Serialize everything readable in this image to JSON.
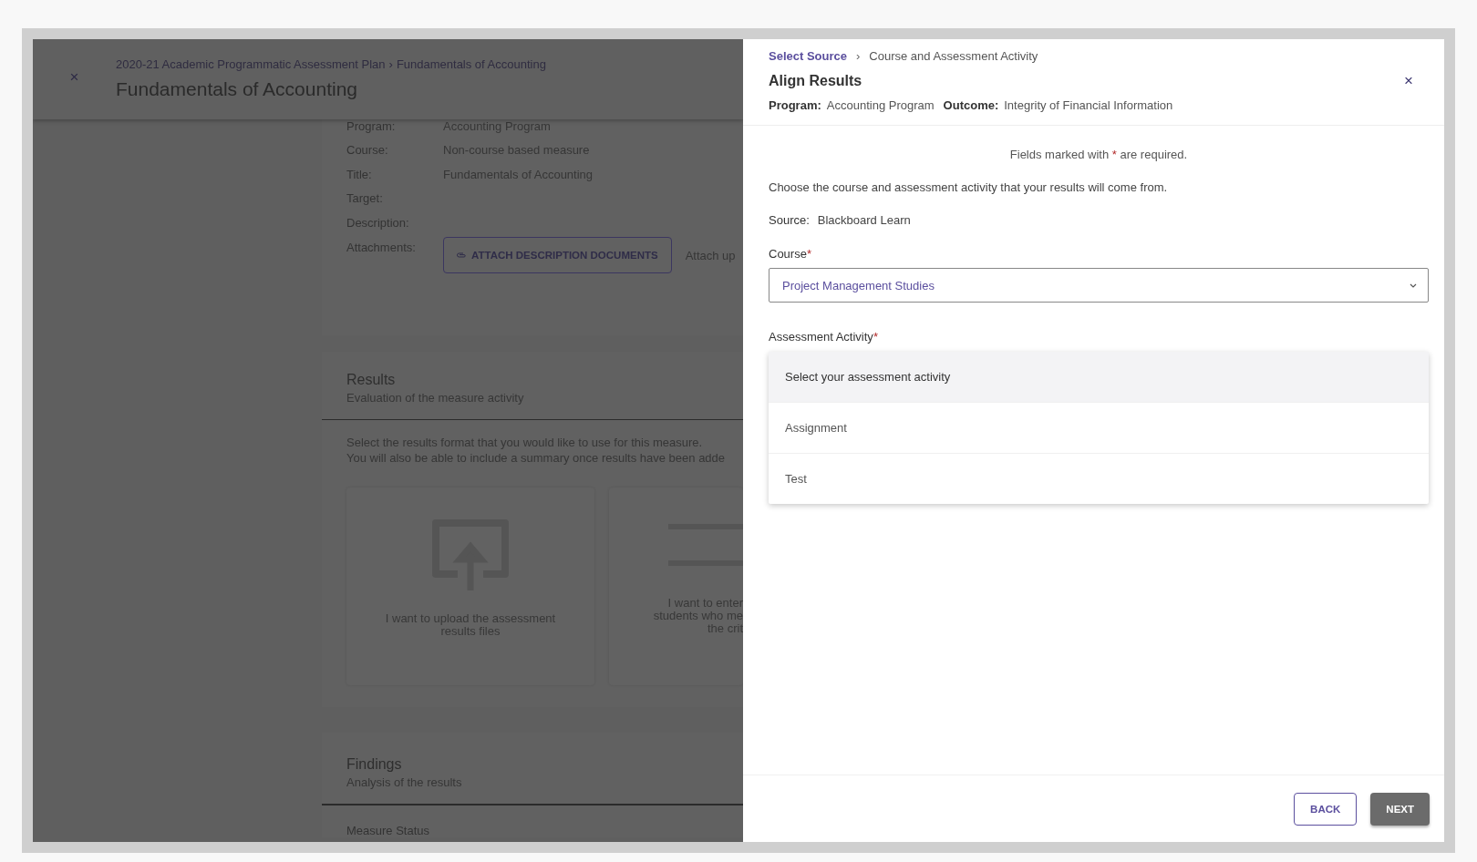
{
  "background_page": {
    "close": "×",
    "breadcrumb": [
      "2020-21 Academic Programmatic Assessment Plan",
      "Fundamentals of Accounting"
    ],
    "breadcrumb_separator": "›",
    "title": "Fundamentals of Accounting",
    "details": [
      {
        "label": "Program:",
        "value": "Accounting Program"
      },
      {
        "label": "Course:",
        "value": "Non-course based measure"
      },
      {
        "label": "Title:",
        "value": "Fundamentals of Accounting"
      },
      {
        "label": "Target:"
      },
      {
        "label": "Description:"
      }
    ],
    "attachments": {
      "label": "Attachments:",
      "button": "ATTACH DESCRIPTION DOCUMENTS",
      "note": "Attach up"
    },
    "results": {
      "title": "Results",
      "subtitle": "Evaluation of the measure activity",
      "instructions": [
        "Select the results format that you would like to use for this measure.",
        "You will also be able to include a summary once results have been adde"
      ],
      "options": [
        {
          "kind": "upload",
          "lines": [
            "I want to upload the assessment",
            "results files"
          ]
        },
        {
          "kind": "enter",
          "lines": [
            "I want to enter",
            "students who me",
            "the crit"
          ]
        }
      ]
    },
    "findings": {
      "title": "Findings",
      "subtitle": "Analysis of the results"
    },
    "measure_status": "Measure Status"
  },
  "panel": {
    "breadcrumb": [
      {
        "label": "Select Source",
        "current": false
      },
      {
        "label": "Course and Assessment Activity",
        "current": true
      }
    ],
    "breadcrumb_separator": "›",
    "title": "Align Results",
    "close": "×",
    "program_label": "Program:",
    "program": "Accounting Program",
    "outcome_label": "Outcome:",
    "outcome": "Integrity of Financial Information",
    "required_note": {
      "before": "Fields marked with ",
      "mark": "*",
      "after": " are required."
    },
    "intro": "Choose the course and assessment activity that your results will come from.",
    "source_label": "Source:",
    "source": "Blackboard Learn",
    "course": {
      "label": "Course",
      "required": true,
      "value": "Project Management Studies"
    },
    "activity": {
      "label": "Assessment Activity",
      "required": true,
      "options": [
        {
          "label": "Select your assessment activity",
          "selected": true
        },
        {
          "label": "Assignment",
          "selected": false
        },
        {
          "label": "Test",
          "selected": false
        }
      ]
    },
    "buttons": [
      {
        "label": "BACK",
        "kind": "outline"
      },
      {
        "label": "NEXT",
        "kind": "filled"
      }
    ]
  }
}
